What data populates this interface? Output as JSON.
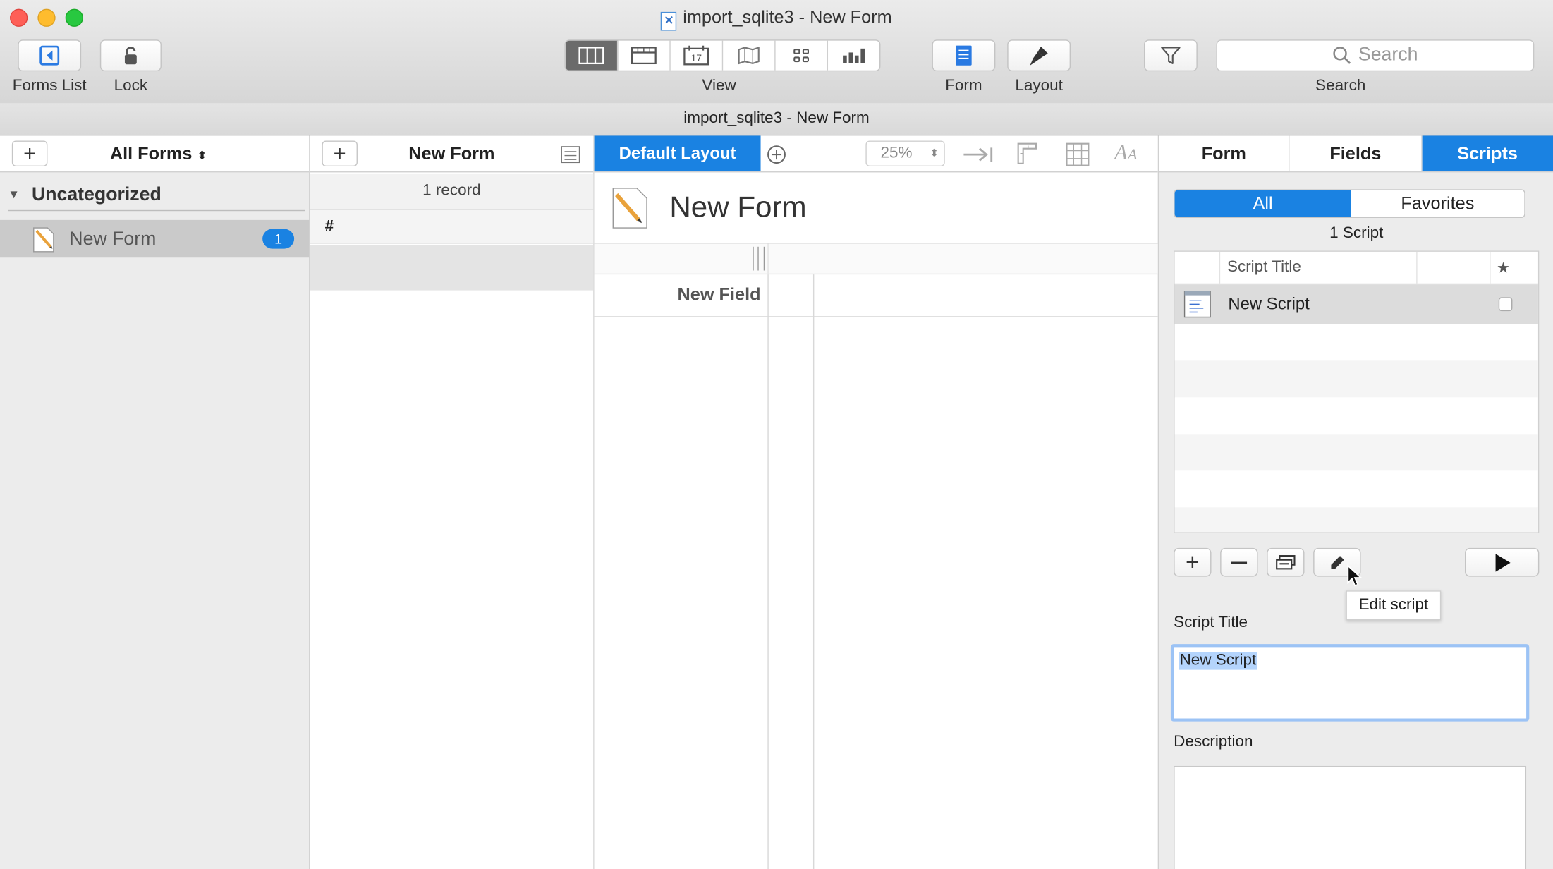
{
  "window": {
    "title": "import_sqlite3 - New Form",
    "subtitle": "import_sqlite3 - New Form"
  },
  "toolbar": {
    "forms_list_label": "Forms List",
    "lock_label": "Lock",
    "view_label": "View",
    "form_label": "Form",
    "layout_label": "Layout",
    "search_label": "Search",
    "search_placeholder": "Search",
    "view_modes": [
      "columns-view-icon",
      "list-view-icon",
      "calendar-view-icon",
      "map-view-icon",
      "tiles-view-icon",
      "chart-view-icon"
    ],
    "calendar_day": "17",
    "selected_view": "columns-view-icon"
  },
  "sidebar": {
    "header_title": "All Forms",
    "group_title": "Uncategorized",
    "items": [
      {
        "label": "New Form",
        "count": "1"
      }
    ]
  },
  "records": {
    "header_title": "New Form",
    "record_count": "1 record",
    "column_header": "#"
  },
  "canvas": {
    "layout_tab": "Default Layout",
    "zoom": "25%",
    "form_title": "New Form",
    "field_label": "New Field"
  },
  "inspector": {
    "tabs": [
      "Form",
      "Fields",
      "Scripts"
    ],
    "active_tab": "Scripts",
    "filter": {
      "all": "All",
      "favorites": "Favorites"
    },
    "script_count": "1 Script",
    "table_headers": {
      "title": "Script Title",
      "favorite": "★"
    },
    "scripts": [
      {
        "title": "New Script",
        "favorite": false
      }
    ],
    "tooltip": "Edit script",
    "script_title_label": "Script Title",
    "script_title_value": "New Script",
    "description_label": "Description",
    "description_value": ""
  },
  "colors": {
    "accent": "#1a82e2",
    "selection": "#b4d4fc",
    "badge": "#1a82e2"
  }
}
